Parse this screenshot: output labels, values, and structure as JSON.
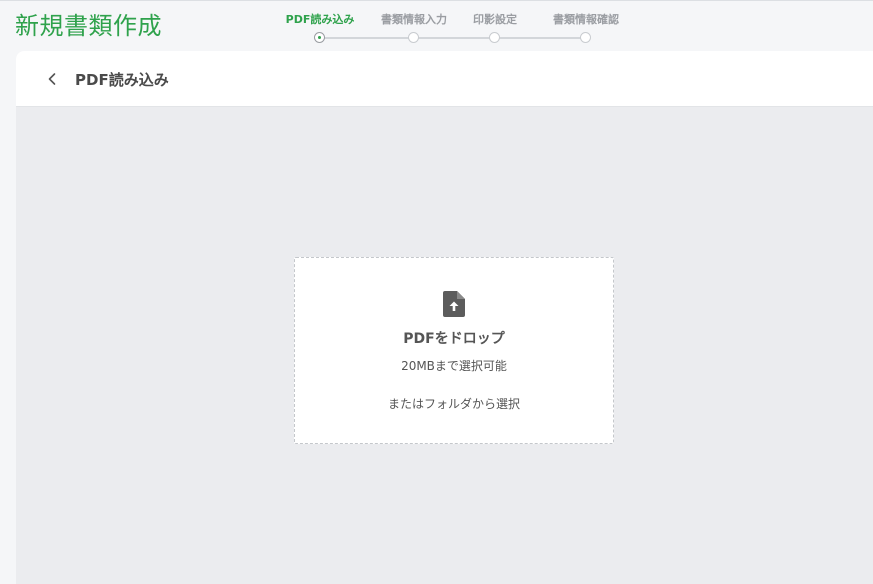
{
  "page": {
    "title": "新規書類作成"
  },
  "stepper": {
    "steps": [
      {
        "label": "PDF読み込み",
        "active": true
      },
      {
        "label": "書類情報入力",
        "active": false
      },
      {
        "label": "印影設定",
        "active": false
      },
      {
        "label": "書類情報確認",
        "active": false
      }
    ]
  },
  "card": {
    "title": "PDF読み込み",
    "back_icon": "chevron-left-icon"
  },
  "dropzone": {
    "icon": "file-upload-icon",
    "title": "PDFをドロップ",
    "limit": "20MBまで選択可能",
    "folder_link": "またはフォルダから選択"
  },
  "colors": {
    "accent": "#2fa24c",
    "step_inactive": "#9a9da2",
    "background": "#ebecef"
  }
}
